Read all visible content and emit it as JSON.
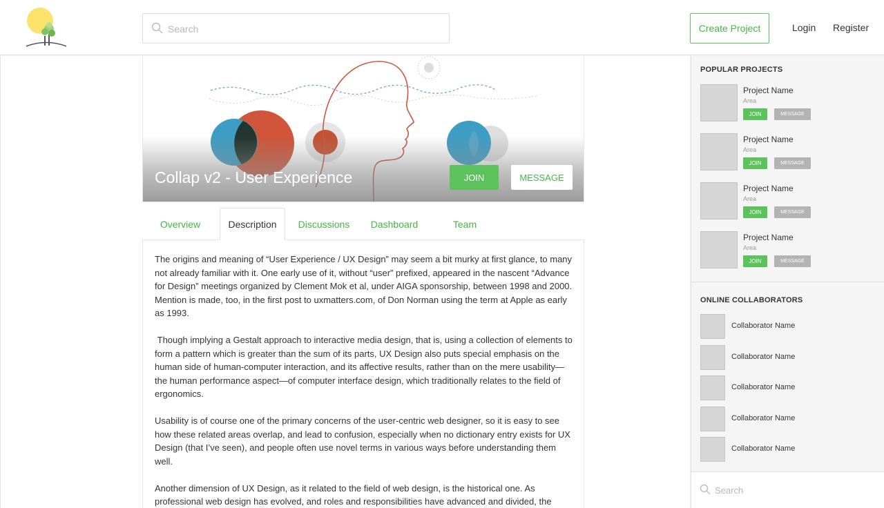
{
  "header": {
    "search_placeholder": "Search",
    "create_project_label": "Create Project",
    "login_label": "Login",
    "register_label": "Register"
  },
  "hero": {
    "title": "Collap v2 - User Experience",
    "join_label": "JOIN",
    "message_label": "MESSAGE"
  },
  "tabs": [
    {
      "label": "Overview",
      "active": false
    },
    {
      "label": "Description",
      "active": true
    },
    {
      "label": "Discussions",
      "active": false
    },
    {
      "label": "Dashboard",
      "active": false
    },
    {
      "label": "Team",
      "active": false
    }
  ],
  "description": {
    "paragraphs": [
      "The origins and meaning of “User Experience / UX Design” may seem a bit murky at first glance, to many not already familiar with it. One early use of it, without “user” prefixed, appeared in the nascent “Advance for Design” meetings organized by Clement Mok et al, under AIGA sponsorship, between 1998 and 2000. Mention is made, too, in the first post to uxmatters.com, of Don Norman using the term at Apple as early as 1993.",
      " Though implying a Gestalt approach to interactive media design, that is, using a collection of elements to form a pattern which is greater than the sum of its parts, UX Design also puts special emphasis on the human side of human-computer interaction, and its affective results, rather than on the mere usability—the human performance aspect—of computer interface design, which traditionally relates to the field of ergonomics.",
      "Usability is of course one of the primary concerns of the user-centric web designer, so it is easy to see how these related areas overlap, and lead to confusion, especially when no dictionary entry exists for UX Design (that I’ve seen), and people often use novel terms in various ways before understanding them well.",
      "Another dimension of UX Design, as it related to the field of web design, is the historical one. As professional web design has evolved, and roles and responsibilities have advanced and divided, the"
    ]
  },
  "sidebar": {
    "popular_title": "POPULAR PROJECTS",
    "projects": [
      {
        "name": "Project Name",
        "area": "Area",
        "join_label": "JOIN",
        "message_label": "MESSAGE"
      },
      {
        "name": "Project Name",
        "area": "Area",
        "join_label": "JOIN",
        "message_label": "MESSAGE"
      },
      {
        "name": "Project Name",
        "area": "Area",
        "join_label": "JOIN",
        "message_label": "MESSAGE"
      },
      {
        "name": "Project Name",
        "area": "Area",
        "join_label": "JOIN",
        "message_label": "MESSAGE"
      }
    ],
    "collab_title": "ONLINE COLLABORATORS",
    "collaborators": [
      {
        "name": "Collaborator Name"
      },
      {
        "name": "Collaborator Name"
      },
      {
        "name": "Collaborator Name"
      },
      {
        "name": "Collaborator Name"
      },
      {
        "name": "Collaborator Name"
      }
    ],
    "search_placeholder": "Search"
  },
  "colors": {
    "accent_green": "#5cc25c",
    "sidebar_bg": "#f5f5f5",
    "circle_blue": "#3e9dc4",
    "circle_orange": "#d0553a"
  },
  "icons": {
    "logo": "tree-sun-logo",
    "search": "search-icon"
  }
}
